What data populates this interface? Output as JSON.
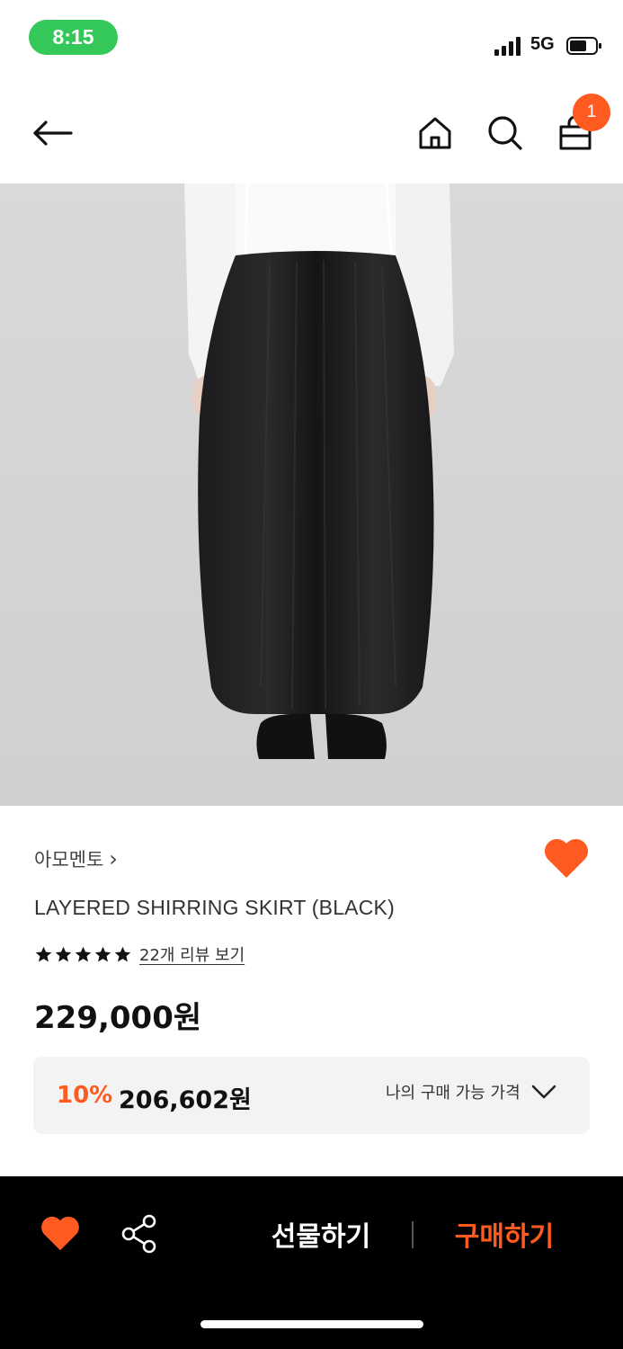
{
  "status_bar": {
    "time": "8:15",
    "network": "5G"
  },
  "nav": {
    "cart_count": "1",
    "back_icon": "arrow-left-icon",
    "home_icon": "home-icon",
    "search_icon": "search-icon",
    "bag_icon": "shopping-bag-icon"
  },
  "product": {
    "brand": "아모멘토",
    "brand_chevron": "›",
    "name": "LAYERED SHIRRING SKIRT (BLACK)",
    "rating_stars": 5,
    "review_link": "22개 리뷰 보기",
    "price": "229,000원",
    "discount": {
      "rate": "10%",
      "price": "206,602원",
      "my_price_label": "나의 구매 가능 가격"
    }
  },
  "bottom_bar": {
    "gift_label": "선물하기",
    "buy_label": "구매하기"
  },
  "colors": {
    "accent": "#ff5a1f",
    "status_green": "#34c759",
    "bottom_bar": "#000000"
  }
}
